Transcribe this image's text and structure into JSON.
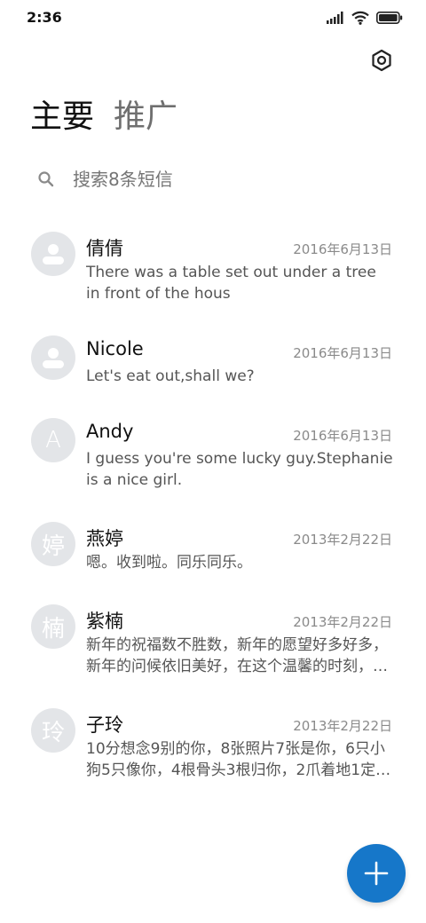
{
  "status_bar": {
    "time": "2:36"
  },
  "tabs": [
    {
      "label": "主要",
      "active": true
    },
    {
      "label": "推广",
      "active": false
    }
  ],
  "search": {
    "placeholder": "搜索8条短信"
  },
  "conversations": [
    {
      "name": "倩倩",
      "date": "2016年6月13日",
      "avatar": "person-icon",
      "avatar_letter": "",
      "preview": "There was a table set out under a tree in front of the hous"
    },
    {
      "name": "Nicole",
      "date": "2016年6月13日",
      "avatar": "person-icon",
      "avatar_letter": "",
      "preview": "Let's eat out,shall we?"
    },
    {
      "name": "Andy",
      "date": "2016年6月13日",
      "avatar": "letter",
      "avatar_letter": "A",
      "preview": "I guess you're some lucky guy.Stephanie is a nice girl."
    },
    {
      "name": "燕婷",
      "date": "2013年2月22日",
      "avatar": "letter",
      "avatar_letter": "婷",
      "preview": "嗯。收到啦。同乐同乐。"
    },
    {
      "name": "紫楠",
      "date": "2013年2月22日",
      "avatar": "letter",
      "avatar_letter": "楠",
      "preview": "新年的祝福数不胜数，新年的愿望好多好多，新年的问候依旧美好，在这个温馨的时刻，…"
    },
    {
      "name": "子玲",
      "date": "2013年2月22日",
      "avatar": "letter",
      "avatar_letter": "玲",
      "preview": "10分想念9别的你，8张照片7张是你，6只小狗5只像你，4根骨头3根归你，2爪着地1定…"
    }
  ],
  "colors": {
    "accent": "#1677c9",
    "avatar_bg": "#e3e5e8"
  },
  "icons": {
    "settings": "settings-icon",
    "search": "search-icon",
    "compose": "plus-icon"
  }
}
